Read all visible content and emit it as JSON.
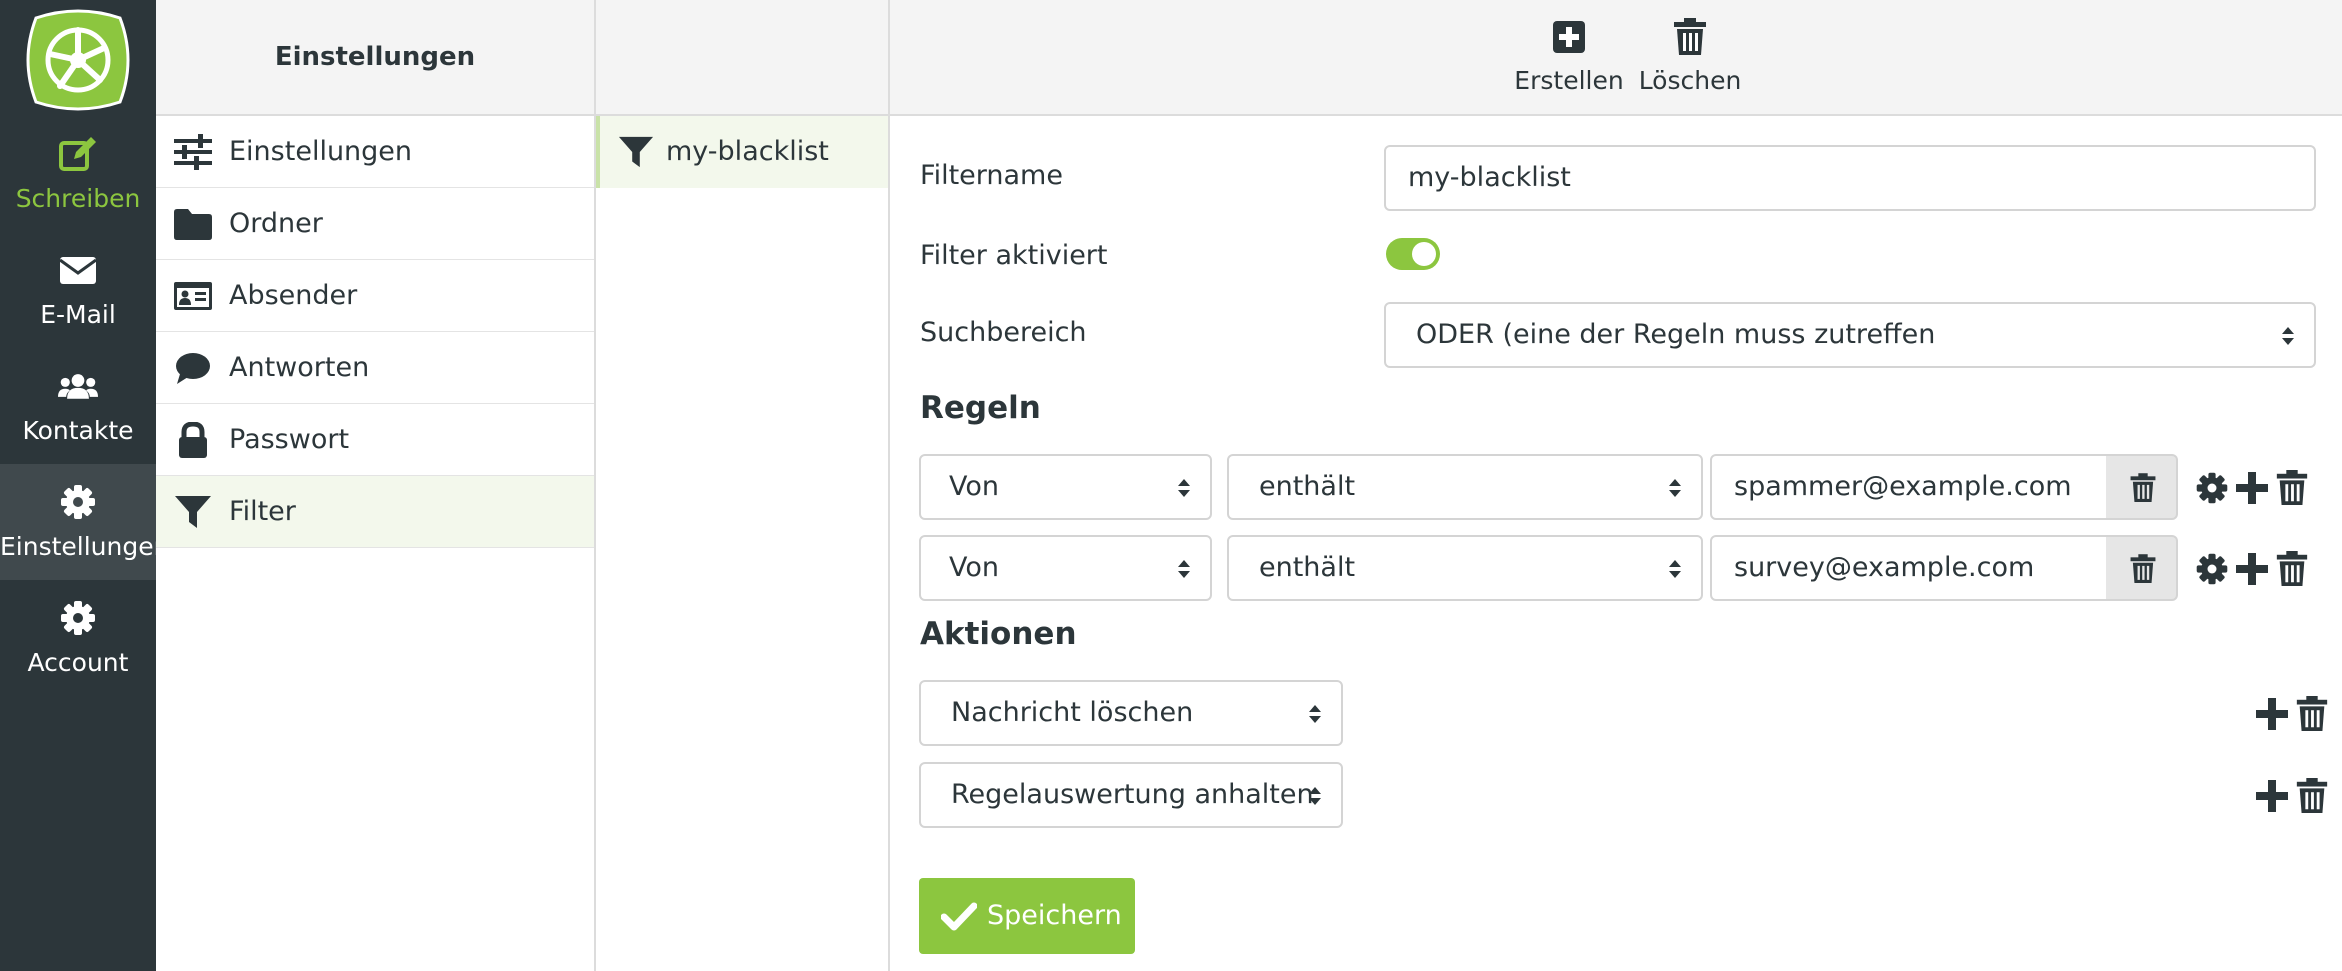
{
  "colors": {
    "accent": "#8cc63f",
    "rail": "#2c363a",
    "rail_selected": "#40494d",
    "active_row": "#f3f8ec"
  },
  "rail": {
    "items": [
      {
        "label": "Schreiben",
        "icon": "edit-icon"
      },
      {
        "label": "E-Mail",
        "icon": "envelope-icon"
      },
      {
        "label": "Kontakte",
        "icon": "users-icon"
      },
      {
        "label": "Einstellungen",
        "icon": "gear-icon"
      },
      {
        "label": "Account",
        "icon": "gear-icon"
      }
    ],
    "selected": "Einstellungen"
  },
  "settings": {
    "title": "Einstellungen",
    "items": [
      {
        "label": "Einstellungen",
        "icon": "sliders-icon"
      },
      {
        "label": "Ordner",
        "icon": "folder-icon"
      },
      {
        "label": "Absender",
        "icon": "id-card-icon"
      },
      {
        "label": "Antworten",
        "icon": "comment-icon"
      },
      {
        "label": "Passwort",
        "icon": "lock-icon"
      },
      {
        "label": "Filter",
        "icon": "filter-icon"
      }
    ],
    "active": "Filter"
  },
  "filters": {
    "items": [
      {
        "label": "my-blacklist",
        "icon": "filter-icon"
      }
    ]
  },
  "toolbar": {
    "create_label": "Erstellen",
    "delete_label": "Löschen"
  },
  "form": {
    "name_label": "Filtername",
    "name_value": "my-blacklist",
    "enabled_label": "Filter aktiviert",
    "enabled": true,
    "scope_label": "Suchbereich",
    "scope_value": "ODER (eine der Regeln muss zutreffen",
    "rules_heading": "Regeln",
    "rules": [
      {
        "field": "Von",
        "operator": "enthält",
        "value": "spammer@example.com"
      },
      {
        "field": "Von",
        "operator": "enthält",
        "value": "survey@example.com"
      }
    ],
    "actions_heading": "Aktionen",
    "actions": [
      {
        "value": "Nachricht löschen"
      },
      {
        "value": "Regelauswertung anhalten"
      }
    ],
    "save_label": "Speichern"
  }
}
